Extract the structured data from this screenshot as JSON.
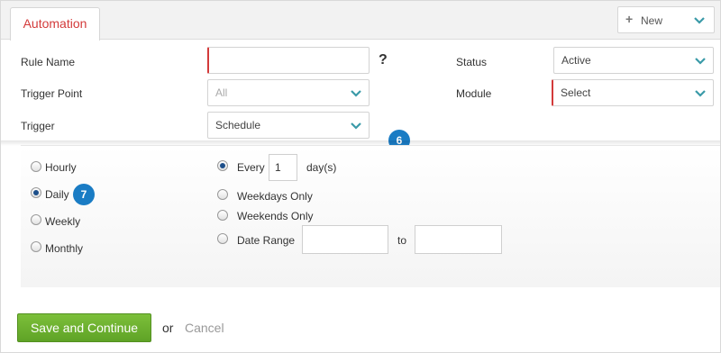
{
  "tabs": [
    {
      "label": "Automation",
      "active": true
    }
  ],
  "toolbar": {
    "new_label": "New",
    "new_icon": "plus-icon"
  },
  "form": {
    "rule_name": {
      "label": "Rule Name",
      "value": "",
      "help": "?"
    },
    "trigger_point": {
      "label": "Trigger Point",
      "value": "All"
    },
    "trigger": {
      "label": "Trigger",
      "value": "Schedule"
    },
    "status": {
      "label": "Status",
      "value": "Active"
    },
    "module": {
      "label": "Module",
      "value": "Select"
    }
  },
  "badges": {
    "step6": "6",
    "step7": "7"
  },
  "schedule": {
    "frequencies": [
      {
        "label": "Hourly",
        "selected": false
      },
      {
        "label": "Daily",
        "selected": true
      },
      {
        "label": "Weekly",
        "selected": false
      },
      {
        "label": "Monthly",
        "selected": false
      }
    ],
    "options": {
      "every_label": "Every",
      "every_value": "1",
      "every_unit": "day(s)",
      "weekdays_label": "Weekdays Only",
      "weekends_label": "Weekends Only",
      "date_range_label": "Date Range",
      "to_label": "to",
      "from_value": "",
      "to_value": ""
    }
  },
  "footer": {
    "save_label": "Save and Continue",
    "or_label": "or",
    "cancel_label": "Cancel"
  },
  "colors": {
    "accent_red": "#d33a3a",
    "chevron_teal": "#3a9aa8",
    "badge_blue": "#1a7cc4",
    "save_green": "#6cb22f"
  }
}
